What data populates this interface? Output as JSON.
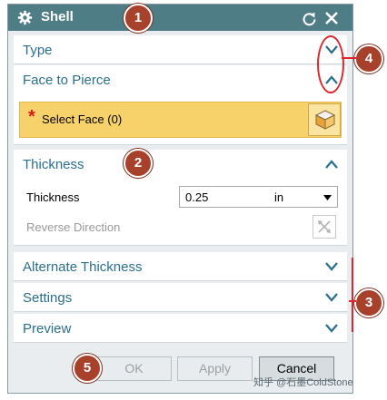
{
  "window": {
    "title": "Shell",
    "icons": [
      "gear-icon",
      "reset-icon",
      "close-icon"
    ]
  },
  "sections": {
    "type": {
      "label": "Type",
      "expanded": false
    },
    "face_to_pierce": {
      "label": "Face to Pierce",
      "expanded": true,
      "select_label": "Select Face (0)",
      "required_mark": "*"
    },
    "thickness": {
      "label": "Thickness",
      "expanded": true,
      "field_label": "Thickness",
      "value": "0.25",
      "unit": "in",
      "reverse_label": "Reverse Direction"
    },
    "alternate_thickness": {
      "label": "Alternate Thickness",
      "expanded": false
    },
    "settings": {
      "label": "Settings",
      "expanded": false
    },
    "preview": {
      "label": "Preview",
      "expanded": false
    }
  },
  "buttons": {
    "ok": "OK",
    "apply": "Apply",
    "cancel": "Cancel"
  },
  "annotations": [
    "1",
    "2",
    "3",
    "4",
    "5"
  ],
  "watermark": "知乎 @石墨ColdStone",
  "colors": {
    "titlebar": "#4e7d86",
    "accent_text": "#2a6f8d",
    "select_highlight": "#f7d26b",
    "annotation": "#a8412b",
    "annotation_line": "#e0262d"
  }
}
